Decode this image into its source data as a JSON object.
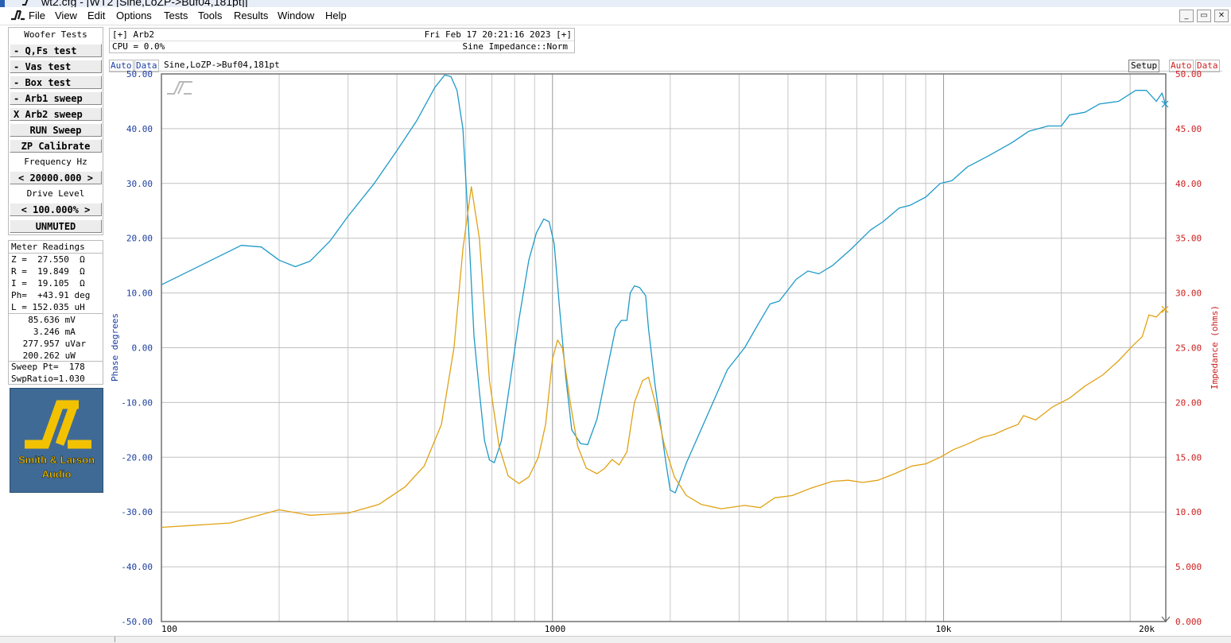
{
  "window": {
    "title": "wt2.cfg - [WT2 [Sine,LoZP->Buf04,181pt]]",
    "buttons": {
      "minimize": "_",
      "restore": "▭",
      "close": "✕"
    }
  },
  "menu": [
    "File",
    "View",
    "Edit",
    "Options",
    "Tests",
    "Tools",
    "Results",
    "Window",
    "Help"
  ],
  "left_panel": {
    "heading": "Woofer Tests",
    "tests": [
      "- Q,Fs test",
      "- Vas test",
      "- Box test",
      "- Arb1 sweep",
      "X Arb2 sweep"
    ],
    "run_label": "RUN Sweep",
    "zp_label": "ZP Calibrate",
    "freq_heading": "Frequency Hz",
    "freq_value": "< 20000.000 >",
    "drive_heading": "Drive Level",
    "drive_value": "< 100.000% >",
    "mute_label": "UNMUTED"
  },
  "meter": {
    "heading": "Meter Readings",
    "lines": [
      "Z =  27.550  Ω",
      "R =  19.849  Ω",
      "I =  19.105  Ω",
      "Ph=  +43.91 deg",
      "L = 152.035 uH",
      "  85.636 mV",
      "   3.246 mA",
      " 277.957 uVar",
      " 200.262 uW"
    ],
    "sweep_pt": "Sweep Pt=  178",
    "sweep_ratio": "SwpRatio=1.030"
  },
  "logo": {
    "line1": "Smith & Larson",
    "line2": "Audio",
    "colors": {
      "bg": "#3f6a96",
      "mark": "#f2c200"
    }
  },
  "header": {
    "tag": "[+] Arb2",
    "datetime": "Fri Feb 17 20:21:16 2023 [+]",
    "cpu": "CPU = 0.0%",
    "mode": "Sine Impedance::Norm"
  },
  "chart_toolbar": {
    "left_auto": "Auto",
    "left_data": "Data",
    "caption": "Sine,LoZP->Buf04,181pt",
    "setup": "Setup",
    "right_auto": "Auto",
    "right_data": "Data"
  },
  "chart_data": {
    "type": "line",
    "xscale": "log",
    "xlim": [
      100,
      20000
    ],
    "x_ticks": [
      "100",
      "1000",
      "10k",
      "20k"
    ],
    "y_left": {
      "label": "Phase degrees",
      "lim": [
        -50,
        50
      ],
      "ticks": [
        "50.00",
        "40.00",
        "30.00",
        "20.00",
        "10.00",
        "0.00",
        "-10.00",
        "-20.00",
        "-30.00",
        "-40.00",
        "-50.00"
      ]
    },
    "y_right": {
      "label": "Impedance (ohms)",
      "lim": [
        0,
        50
      ],
      "ticks": [
        "50.00",
        "45.00",
        "40.00",
        "35.00",
        "30.00",
        "25.00",
        "20.00",
        "15.00",
        "10.00",
        "5.000",
        "0.000"
      ]
    },
    "grid": true,
    "colors": {
      "phase": "#1e9ac8",
      "impedance": "#e0a214",
      "left_axis": "#1c3fa0",
      "right_axis": "#cc1f1f"
    },
    "series": [
      {
        "axis": "left",
        "color": "#1e9ac8",
        "points": [
          [
            100,
            11.5
          ],
          [
            130,
            15.5
          ],
          [
            160,
            18.7
          ],
          [
            180,
            18.4
          ],
          [
            200,
            16
          ],
          [
            220,
            14.8
          ],
          [
            240,
            15.8
          ],
          [
            270,
            19.5
          ],
          [
            300,
            24
          ],
          [
            350,
            30
          ],
          [
            400,
            36
          ],
          [
            450,
            41.5
          ],
          [
            500,
            47.5
          ],
          [
            530,
            49.8
          ],
          [
            550,
            49.5
          ],
          [
            570,
            47
          ],
          [
            590,
            40
          ],
          [
            610,
            22
          ],
          [
            630,
            2
          ],
          [
            650,
            -8
          ],
          [
            670,
            -17
          ],
          [
            690,
            -20.5
          ],
          [
            710,
            -21
          ],
          [
            740,
            -17
          ],
          [
            780,
            -6
          ],
          [
            820,
            5
          ],
          [
            870,
            16
          ],
          [
            910,
            21
          ],
          [
            950,
            23.5
          ],
          [
            980,
            23
          ],
          [
            1010,
            19
          ],
          [
            1040,
            8
          ],
          [
            1080,
            -5
          ],
          [
            1120,
            -15
          ],
          [
            1180,
            -17.5
          ],
          [
            1230,
            -17.7
          ],
          [
            1300,
            -13
          ],
          [
            1370,
            -5
          ],
          [
            1450,
            3.5
          ],
          [
            1500,
            5
          ],
          [
            1550,
            5
          ],
          [
            1580,
            10
          ],
          [
            1620,
            11.3
          ],
          [
            1670,
            11
          ],
          [
            1730,
            9.5
          ],
          [
            1760,
            3.5
          ],
          [
            1830,
            -7
          ],
          [
            1950,
            -21
          ],
          [
            2000,
            -26
          ],
          [
            2060,
            -26.5
          ],
          [
            2200,
            -21
          ],
          [
            2500,
            -12
          ],
          [
            2800,
            -4
          ],
          [
            3100,
            0
          ],
          [
            3400,
            5
          ],
          [
            3600,
            8
          ],
          [
            3800,
            8.5
          ],
          [
            4200,
            12.5
          ],
          [
            4500,
            14
          ],
          [
            4800,
            13.5
          ],
          [
            5200,
            15
          ],
          [
            5800,
            18
          ],
          [
            6500,
            21.5
          ],
          [
            7000,
            23
          ],
          [
            7700,
            25.5
          ],
          [
            8200,
            26
          ],
          [
            9000,
            27.5
          ],
          [
            9800,
            30
          ],
          [
            10500,
            30.5
          ],
          [
            11500,
            33
          ],
          [
            13000,
            35
          ],
          [
            15000,
            37.5
          ],
          [
            16500,
            39.5
          ],
          [
            18500,
            40.5
          ],
          [
            20000,
            40.5
          ],
          [
            21000,
            42.5
          ],
          [
            23000,
            43
          ],
          [
            25000,
            44.5
          ],
          [
            28000,
            45
          ],
          [
            31000,
            47
          ],
          [
            33000,
            47
          ],
          [
            35000,
            45
          ],
          [
            36200,
            46.5
          ],
          [
            36900,
            44.5
          ]
        ]
      },
      {
        "axis": "right",
        "color": "#e0a214",
        "points": [
          [
            100,
            8.6
          ],
          [
            150,
            9.0
          ],
          [
            200,
            10.2
          ],
          [
            240,
            9.7
          ],
          [
            300,
            9.9
          ],
          [
            360,
            10.7
          ],
          [
            420,
            12.3
          ],
          [
            470,
            14.2
          ],
          [
            520,
            18
          ],
          [
            560,
            25
          ],
          [
            590,
            34
          ],
          [
            620,
            39.7
          ],
          [
            650,
            35
          ],
          [
            690,
            22
          ],
          [
            730,
            16
          ],
          [
            770,
            13.3
          ],
          [
            820,
            12.6
          ],
          [
            870,
            13.2
          ],
          [
            920,
            15
          ],
          [
            960,
            18
          ],
          [
            1000,
            24
          ],
          [
            1030,
            25.7
          ],
          [
            1060,
            25.0
          ],
          [
            1110,
            20
          ],
          [
            1160,
            16
          ],
          [
            1220,
            14
          ],
          [
            1300,
            13.5
          ],
          [
            1360,
            14
          ],
          [
            1420,
            14.8
          ],
          [
            1480,
            14.3
          ],
          [
            1550,
            15.5
          ],
          [
            1620,
            20
          ],
          [
            1700,
            22
          ],
          [
            1760,
            22.3
          ],
          [
            1830,
            20
          ],
          [
            1930,
            16.2
          ],
          [
            2050,
            13.2
          ],
          [
            2200,
            11.5
          ],
          [
            2400,
            10.7
          ],
          [
            2700,
            10.3
          ],
          [
            3100,
            10.6
          ],
          [
            3400,
            10.4
          ],
          [
            3700,
            11.3
          ],
          [
            4100,
            11.5
          ],
          [
            4600,
            12.2
          ],
          [
            5200,
            12.8
          ],
          [
            5700,
            12.9
          ],
          [
            6200,
            12.7
          ],
          [
            6800,
            12.9
          ],
          [
            7500,
            13.5
          ],
          [
            8300,
            14.2
          ],
          [
            9000,
            14.4
          ],
          [
            9800,
            15.0
          ],
          [
            10600,
            15.7
          ],
          [
            11500,
            16.2
          ],
          [
            12500,
            16.8
          ],
          [
            13500,
            17.1
          ],
          [
            14500,
            17.6
          ],
          [
            15500,
            18.0
          ],
          [
            16000,
            18.8
          ],
          [
            17200,
            18.4
          ],
          [
            19000,
            19.6
          ],
          [
            21000,
            20.4
          ],
          [
            23000,
            21.5
          ],
          [
            25500,
            22.5
          ],
          [
            28000,
            23.8
          ],
          [
            30500,
            25.2
          ],
          [
            32200,
            26.0
          ],
          [
            33500,
            28.0
          ],
          [
            35000,
            27.8
          ],
          [
            36500,
            28.5
          ]
        ]
      }
    ]
  }
}
